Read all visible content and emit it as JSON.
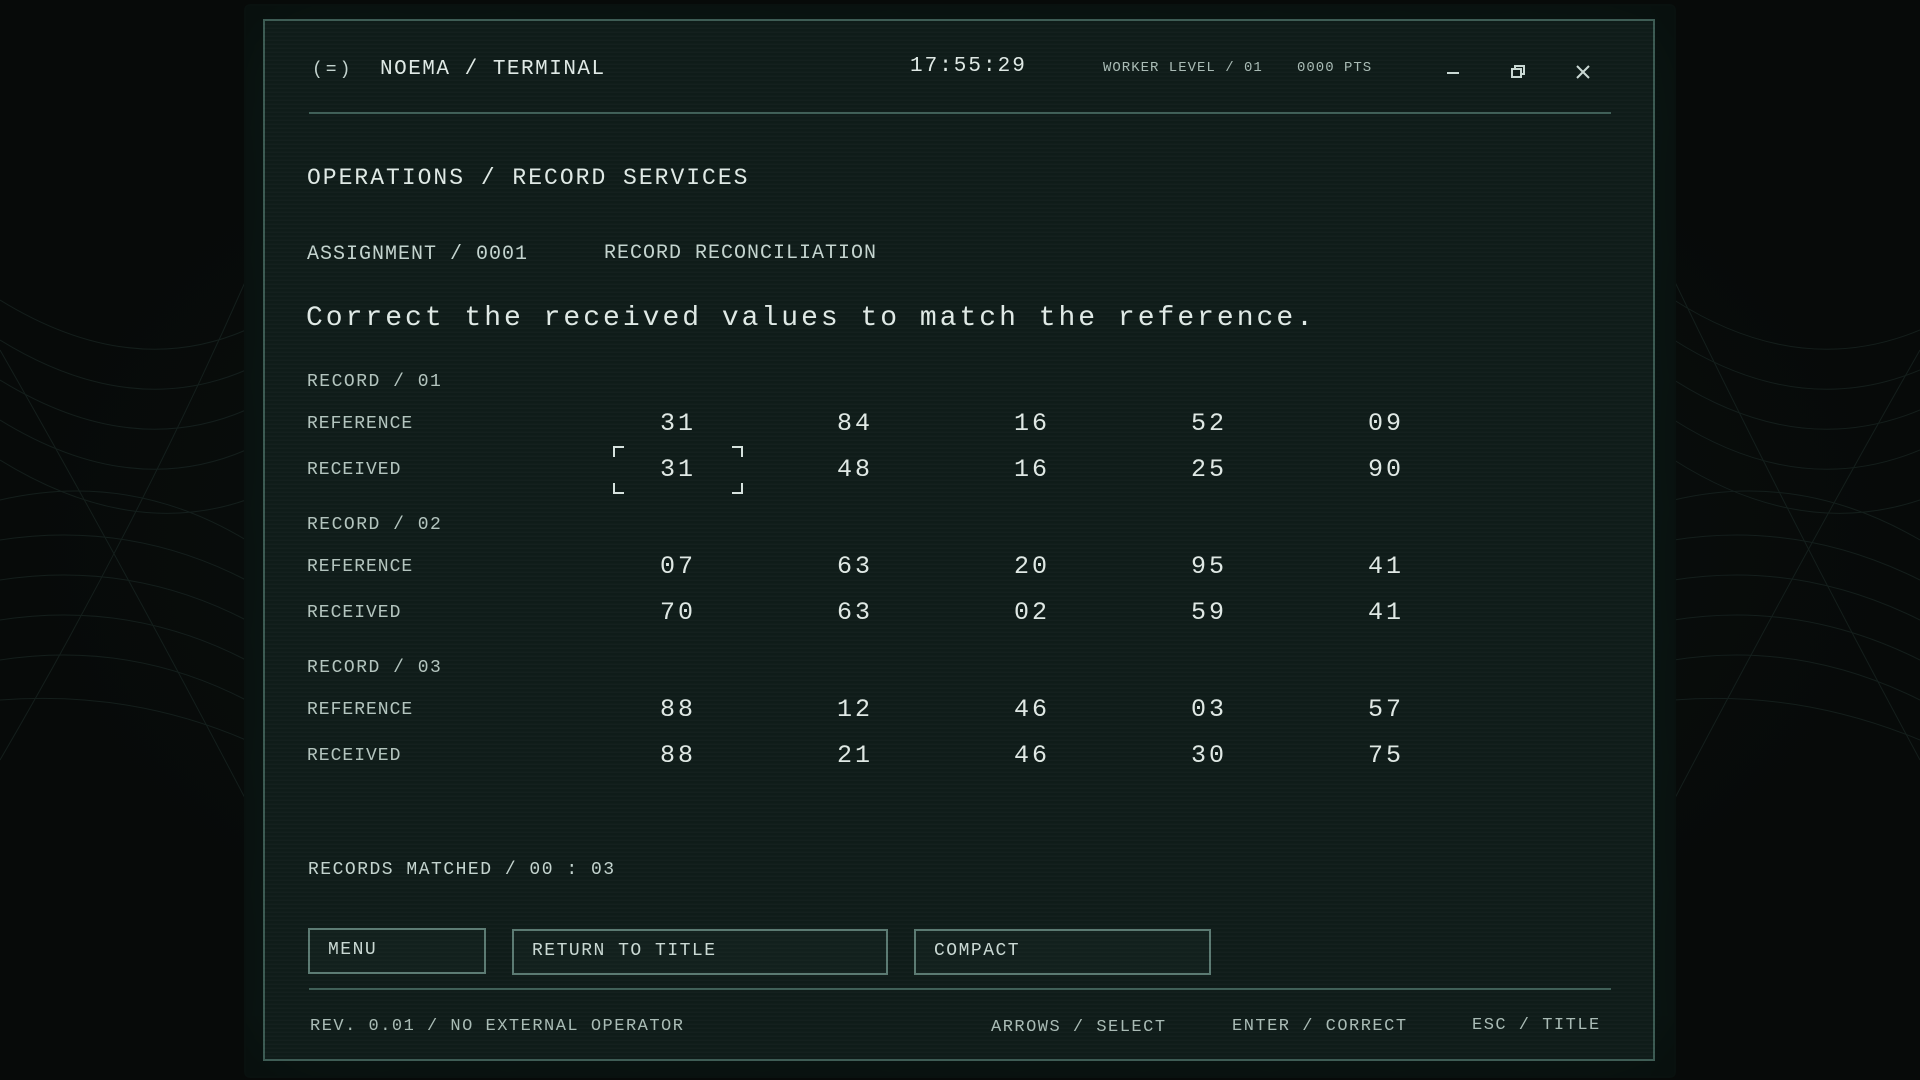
{
  "titlebar": {
    "logo": "(=)",
    "title": "NOEMA / TERMINAL",
    "clock": "17:55:29",
    "worker_level": "WORKER LEVEL / 01",
    "points": "0000 PTS"
  },
  "breadcrumb": "OPERATIONS / RECORD SERVICES",
  "assignment": {
    "id": "ASSIGNMENT / 0001",
    "name": "RECORD RECONCILIATION"
  },
  "instruction": "Correct the received values to match the reference.",
  "records": [
    {
      "label": "RECORD / 01",
      "reference_label": "REFERENCE",
      "received_label": "RECEIVED",
      "reference": [
        "31",
        "84",
        "16",
        "52",
        "09"
      ],
      "received": [
        "31",
        "48",
        "16",
        "25",
        "90"
      ]
    },
    {
      "label": "RECORD / 02",
      "reference_label": "REFERENCE",
      "received_label": "RECEIVED",
      "reference": [
        "07",
        "63",
        "20",
        "95",
        "41"
      ],
      "received": [
        "70",
        "63",
        "02",
        "59",
        "41"
      ]
    },
    {
      "label": "RECORD / 03",
      "reference_label": "REFERENCE",
      "received_label": "RECEIVED",
      "reference": [
        "88",
        "12",
        "46",
        "03",
        "57"
      ],
      "received": [
        "88",
        "21",
        "46",
        "30",
        "75"
      ]
    }
  ],
  "selection": {
    "record": 1,
    "cell": 1
  },
  "status": "RECORDS MATCHED / 00 : 03",
  "buttons": {
    "menu": "MENU",
    "return_to_title": "RETURN TO TITLE",
    "compact": "COMPACT"
  },
  "footer": {
    "revision": "REV. 0.01 / NO EXTERNAL OPERATOR",
    "hint_select": "ARROWS / SELECT",
    "hint_correct": "ENTER / CORRECT",
    "hint_title": "ESC / TITLE"
  },
  "colors": {
    "background": "#070a09",
    "panel": "#0f1c19",
    "border": "#3b5a52",
    "text": "#c3d3ce"
  }
}
